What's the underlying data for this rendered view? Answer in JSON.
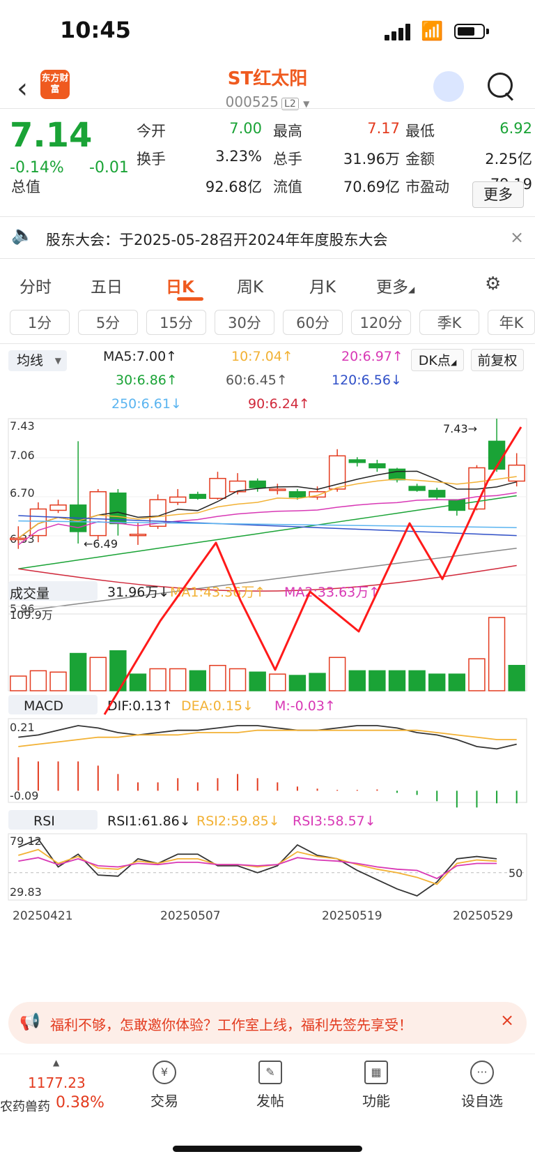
{
  "status": {
    "time": "10:45"
  },
  "header": {
    "name": "ST红太阳",
    "code": "000525",
    "level": "L2",
    "logo_text": "东方财富"
  },
  "quote": {
    "price": "7.14",
    "change_pct": "-0.14%",
    "change": "-0.01",
    "stats": [
      {
        "label": "今开",
        "value": "7.00",
        "color": "#1aa336"
      },
      {
        "label": "最高",
        "value": "7.17",
        "color": "#e33b1f"
      },
      {
        "label": "最低",
        "value": "6.92",
        "color": "#1aa336"
      },
      {
        "label": "换手",
        "value": "3.23%",
        "color": "#222"
      },
      {
        "label": "总手",
        "value": "31.96万",
        "color": "#222"
      },
      {
        "label": "金额",
        "value": "2.25亿",
        "color": "#222"
      },
      {
        "label": "总值",
        "value": "92.68亿",
        "color": "#222"
      },
      {
        "label": "流值",
        "value": "70.69亿",
        "color": "#222"
      },
      {
        "label": "市盈动",
        "value": "79.19",
        "color": "#222"
      }
    ],
    "more": "更多"
  },
  "notice": {
    "text": "股东大会：于2025-05-28召开2024年年度股东大会"
  },
  "tabs": [
    "分时",
    "五日",
    "日K",
    "周K",
    "月K",
    "更多"
  ],
  "periods": [
    "1分",
    "5分",
    "15分",
    "30分",
    "60分",
    "120分",
    "季K",
    "年K"
  ],
  "ma": {
    "selector": "均线",
    "items": [
      {
        "text": "MA5:7.00↑",
        "color": "#222"
      },
      {
        "text": "10:7.04↑",
        "color": "#f2b134"
      },
      {
        "text": "20:6.97↑",
        "color": "#d838b5"
      },
      {
        "text": "30:6.86↑",
        "color": "#1aa336"
      },
      {
        "text": "60:6.45↑",
        "color": "#555555"
      },
      {
        "text": "120:6.56↓",
        "color": "#3050c8"
      },
      {
        "text": "250:6.61↓",
        "color": "#5ab4f0"
      },
      {
        "text": "90:6.24↑",
        "color": "#d0283a"
      }
    ],
    "dk": "DK点",
    "adjust": "前复权"
  },
  "chart_labels": {
    "price_ticks": [
      "7.43",
      "7.06",
      "6.70",
      "6.33",
      "5.96"
    ],
    "high_mark": "7.43→",
    "low_mark": "←6.49",
    "vol_selector": "成交量",
    "vol_items": [
      {
        "text": "31.96万↓",
        "color": "#222"
      },
      {
        "text": "MA1:43.36万↑",
        "color": "#f2b134"
      },
      {
        "text": "MA2:33.63万↑",
        "color": "#d838b5"
      }
    ],
    "vol_max": "109.9万",
    "macd_selector": "MACD",
    "macd_items": [
      {
        "text": "DIF:0.13↑",
        "color": "#222"
      },
      {
        "text": "DEA:0.15↓",
        "color": "#f2b134"
      },
      {
        "text": "M:-0.03↑",
        "color": "#d838b5"
      }
    ],
    "macd_top": "0.21",
    "macd_bottom": "-0.09",
    "rsi_selector": "RSI",
    "rsi_items": [
      {
        "text": "RSI1:61.86↓",
        "color": "#222"
      },
      {
        "text": "RSI2:59.85↓",
        "color": "#f2b134"
      },
      {
        "text": "RSI3:58.57↓",
        "color": "#d838b5"
      }
    ],
    "rsi_top": "79.12",
    "rsi_bottom": "29.83",
    "rsi_ref": "50",
    "dates": [
      "20250421",
      "20250507",
      "20250519",
      "20250529"
    ]
  },
  "chart_data": {
    "type": "candlestick",
    "ylim": [
      5.96,
      7.43
    ],
    "candles": [
      {
        "o": 6.52,
        "c": 6.53,
        "h": 6.62,
        "l": 6.45
      },
      {
        "o": 6.55,
        "c": 6.75,
        "h": 6.8,
        "l": 6.5
      },
      {
        "o": 6.74,
        "c": 6.78,
        "h": 6.82,
        "l": 6.72
      },
      {
        "o": 6.78,
        "c": 6.58,
        "h": 7.26,
        "l": 6.49
      },
      {
        "o": 6.55,
        "c": 6.88,
        "h": 6.9,
        "l": 6.52
      },
      {
        "o": 6.87,
        "c": 6.64,
        "h": 6.9,
        "l": 6.55
      },
      {
        "o": 6.55,
        "c": 6.56,
        "h": 6.65,
        "l": 6.48
      },
      {
        "o": 6.62,
        "c": 6.82,
        "h": 6.86,
        "l": 6.6
      },
      {
        "o": 6.8,
        "c": 6.84,
        "h": 6.9,
        "l": 6.78
      },
      {
        "o": 6.86,
        "c": 6.83,
        "h": 6.88,
        "l": 6.82
      },
      {
        "o": 6.83,
        "c": 6.98,
        "h": 7.03,
        "l": 6.82
      },
      {
        "o": 6.88,
        "c": 6.96,
        "h": 7.02,
        "l": 6.86
      },
      {
        "o": 6.96,
        "c": 6.91,
        "h": 6.98,
        "l": 6.88
      },
      {
        "o": 6.9,
        "c": 6.9,
        "h": 6.94,
        "l": 6.86
      },
      {
        "o": 6.88,
        "c": 6.84,
        "h": 6.9,
        "l": 6.82
      },
      {
        "o": 6.84,
        "c": 6.88,
        "h": 6.92,
        "l": 6.82
      },
      {
        "o": 6.9,
        "c": 7.15,
        "h": 7.2,
        "l": 6.88
      },
      {
        "o": 7.12,
        "c": 7.1,
        "h": 7.14,
        "l": 7.07
      },
      {
        "o": 7.09,
        "c": 7.06,
        "h": 7.12,
        "l": 7.03
      },
      {
        "o": 7.05,
        "c": 6.97,
        "h": 7.06,
        "l": 6.95
      },
      {
        "o": 6.92,
        "c": 6.89,
        "h": 6.94,
        "l": 6.88
      },
      {
        "o": 6.89,
        "c": 6.84,
        "h": 6.91,
        "l": 6.82
      },
      {
        "o": 6.82,
        "c": 6.74,
        "h": 6.82,
        "l": 6.7
      },
      {
        "o": 6.75,
        "c": 7.06,
        "h": 7.08,
        "l": 6.74
      },
      {
        "o": 7.26,
        "c": 7.05,
        "h": 7.43,
        "l": 7.03
      },
      {
        "o": 6.96,
        "c": 7.08,
        "h": 7.17,
        "l": 6.92
      }
    ],
    "volume": [
      22,
      30,
      28,
      56,
      50,
      60,
      25,
      33,
      33,
      30,
      38,
      33,
      28,
      25,
      23,
      26,
      50,
      30,
      30,
      30,
      30,
      25,
      25,
      48,
      110,
      38
    ],
    "vol_up": [
      true,
      true,
      true,
      false,
      true,
      false,
      false,
      true,
      true,
      false,
      true,
      true,
      false,
      true,
      false,
      false,
      true,
      false,
      false,
      false,
      false,
      false,
      false,
      true,
      true,
      false
    ],
    "dif": [
      0.16,
      0.17,
      0.19,
      0.21,
      0.2,
      0.18,
      0.17,
      0.18,
      0.19,
      0.19,
      0.2,
      0.21,
      0.21,
      0.2,
      0.19,
      0.19,
      0.2,
      0.21,
      0.21,
      0.2,
      0.18,
      0.17,
      0.15,
      0.12,
      0.11,
      0.13
    ],
    "dea": [
      0.12,
      0.13,
      0.14,
      0.15,
      0.16,
      0.16,
      0.17,
      0.17,
      0.17,
      0.18,
      0.18,
      0.18,
      0.19,
      0.19,
      0.19,
      0.19,
      0.19,
      0.19,
      0.19,
      0.19,
      0.19,
      0.18,
      0.17,
      0.16,
      0.15,
      0.15
    ],
    "macd_m": [
      0.08,
      0.07,
      0.07,
      0.07,
      0.06,
      0.04,
      0.02,
      0.02,
      0.03,
      0.02,
      0.03,
      0.04,
      0.03,
      0.02,
      0.01,
      0.005,
      0.002,
      0.002,
      0.003,
      -0.005,
      -0.01,
      -0.025,
      -0.04,
      -0.04,
      -0.03,
      -0.03
    ],
    "rsi1": [
      72,
      79,
      55,
      66,
      48,
      47,
      62,
      58,
      66,
      66,
      56,
      56,
      50,
      56,
      74,
      65,
      62,
      52,
      44,
      36,
      30,
      42,
      62,
      64,
      62
    ],
    "rsi2": [
      65,
      70,
      58,
      64,
      54,
      53,
      60,
      58,
      62,
      62,
      57,
      57,
      55,
      57,
      68,
      64,
      62,
      57,
      53,
      50,
      46,
      40,
      58,
      61,
      60
    ],
    "rsi3": [
      60,
      63,
      57,
      62,
      56,
      55,
      58,
      57,
      59,
      59,
      57,
      57,
      56,
      57,
      63,
      61,
      60,
      58,
      55,
      53,
      52,
      45,
      56,
      58,
      58
    ]
  },
  "promo": {
    "text": "福利不够，怎敢邀你体验？工作室上线，福利先签先享受！"
  },
  "bottom": {
    "index_value": "1177.23",
    "index_name": "农药兽药",
    "index_pct": "0.38%",
    "nav": [
      {
        "label": "交易",
        "icon": "¥"
      },
      {
        "label": "发帖",
        "icon": "✎"
      },
      {
        "label": "功能",
        "icon": "▦"
      },
      {
        "label": "设自选",
        "icon": "···"
      }
    ]
  }
}
